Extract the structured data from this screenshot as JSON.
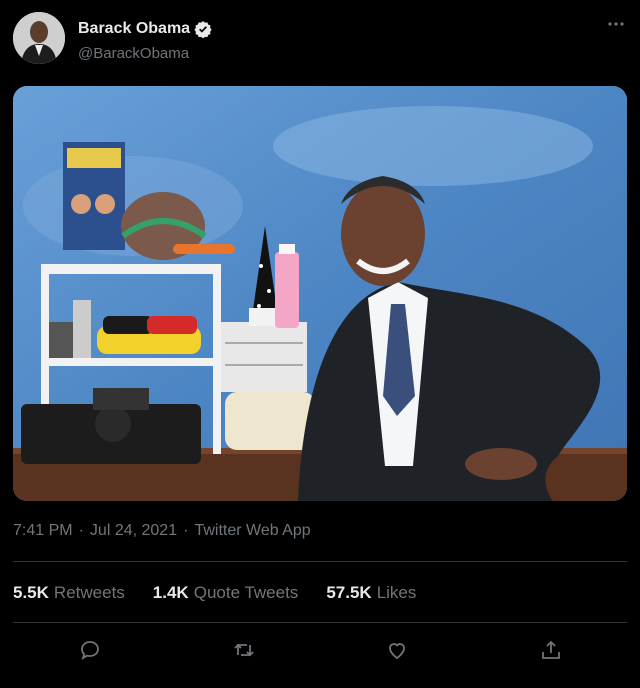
{
  "tweet": {
    "author_name": "Barack Obama",
    "author_handle": "@BarackObama",
    "verified": true,
    "timestamp": "7:41 PM",
    "date": "Jul 24, 2021",
    "source": "Twitter Web App",
    "separator": "·"
  },
  "stats": {
    "retweets_value": "5.5K",
    "retweets_label": "Retweets",
    "quote_value": "1.4K",
    "quote_label": "Quote Tweets",
    "likes_value": "57.5K",
    "likes_label": "Likes"
  },
  "icons": {
    "more": "more-icon",
    "reply": "reply-icon",
    "retweet": "retweet-icon",
    "like": "heart-icon",
    "share": "share-icon",
    "verified": "verified-badge-icon"
  },
  "colors": {
    "background": "#000000",
    "text": "#e7e9ea",
    "muted": "#71767b",
    "divider": "#2f3336",
    "backdrop": "#5b8fcb"
  }
}
